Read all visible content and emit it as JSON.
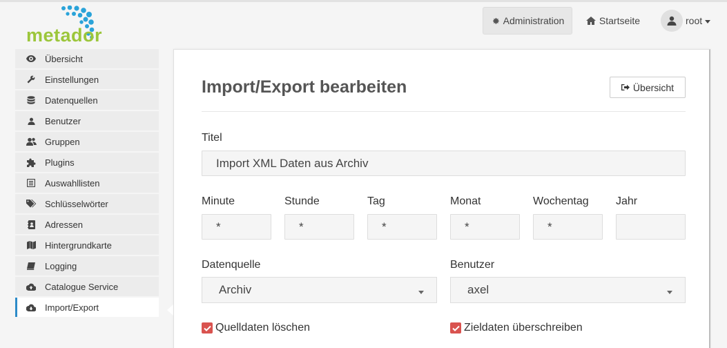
{
  "brand": {
    "logo_text": "metador"
  },
  "topnav": {
    "admin_label": "Administration",
    "home_label": "Startseite",
    "user_label": "root"
  },
  "sidebar": {
    "items": [
      {
        "label": "Übersicht",
        "icon": "eye-icon"
      },
      {
        "label": "Einstellungen",
        "icon": "wrench-icon"
      },
      {
        "label": "Datenquellen",
        "icon": "database-icon"
      },
      {
        "label": "Benutzer",
        "icon": "user-icon"
      },
      {
        "label": "Gruppen",
        "icon": "users-icon"
      },
      {
        "label": "Plugins",
        "icon": "puzzle-icon"
      },
      {
        "label": "Auswahllisten",
        "icon": "list-icon"
      },
      {
        "label": "Schlüsselwörter",
        "icon": "tags-icon"
      },
      {
        "label": "Adressen",
        "icon": "address-book-icon"
      },
      {
        "label": "Hintergrundkarte",
        "icon": "map-icon"
      },
      {
        "label": "Logging",
        "icon": "book-icon"
      },
      {
        "label": "Catalogue Service",
        "icon": "cloud-upload-icon"
      },
      {
        "label": "Import/Export",
        "icon": "cloud-download-icon",
        "active": true
      }
    ]
  },
  "main": {
    "title": "Import/Export bearbeiten",
    "back_button": "Übersicht",
    "fields": {
      "titel": {
        "label": "Titel",
        "value": "Import XML Daten aus Archiv"
      },
      "minute": {
        "label": "Minute",
        "value": "*"
      },
      "stunde": {
        "label": "Stunde",
        "value": "*"
      },
      "tag": {
        "label": "Tag",
        "value": "*"
      },
      "monat": {
        "label": "Monat",
        "value": "*"
      },
      "wochentag": {
        "label": "Wochentag",
        "value": "*"
      },
      "jahr": {
        "label": "Jahr",
        "value": ""
      },
      "datenquelle": {
        "label": "Datenquelle",
        "value": "Archiv"
      },
      "benutzer": {
        "label": "Benutzer",
        "value": "axel"
      }
    },
    "checkboxes": {
      "quelldaten": {
        "label": "Quelldaten löschen",
        "checked": true
      },
      "zieldaten": {
        "label": "Zieldaten überschreiben",
        "checked": true
      }
    }
  },
  "colors": {
    "accent": "#2d8bc8",
    "logo_green": "#9cc63b",
    "logo_blue": "#2aa3d9",
    "checkbox": "#d9534f"
  }
}
